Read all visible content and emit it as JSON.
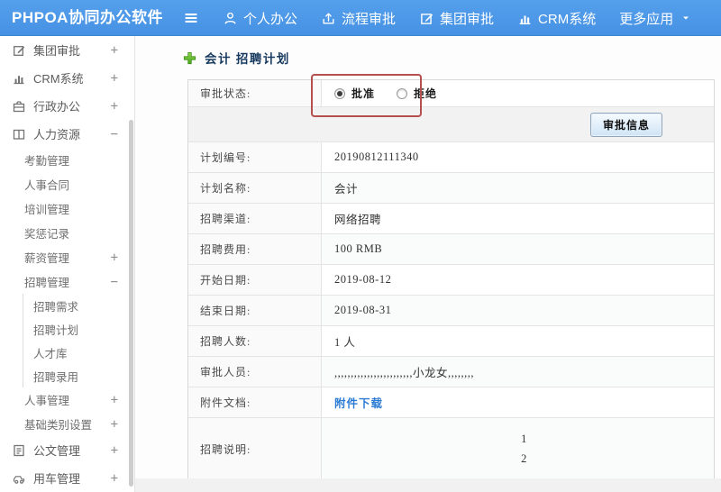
{
  "topbar": {
    "brand": "PHPOA协同办公软件",
    "nav": [
      {
        "label": "个人办公",
        "icon": "user-icon"
      },
      {
        "label": "流程审批",
        "icon": "flow-icon"
      },
      {
        "label": "集团审批",
        "icon": "edit-icon"
      },
      {
        "label": "CRM系统",
        "icon": "chart-icon"
      },
      {
        "label": "更多应用",
        "icon": "caret-down-icon"
      }
    ]
  },
  "sidebar": {
    "items": [
      {
        "label": "集团审批",
        "icon": "edit-icon",
        "level": 1,
        "expander": "+"
      },
      {
        "label": "CRM系统",
        "icon": "chart-icon",
        "level": 1,
        "expander": "+"
      },
      {
        "label": "行政办公",
        "icon": "briefcase-icon",
        "level": 1,
        "expander": "+"
      },
      {
        "label": "人力资源",
        "icon": "book-icon",
        "level": 1,
        "expander": "−"
      },
      {
        "label": "考勤管理",
        "level": 2
      },
      {
        "label": "人事合同",
        "level": 2
      },
      {
        "label": "培训管理",
        "level": 2
      },
      {
        "label": "奖惩记录",
        "level": 2
      },
      {
        "label": "薪资管理",
        "level": 2,
        "expander": "+"
      },
      {
        "label": "招聘管理",
        "level": 2,
        "expander": "−"
      },
      {
        "label": "招聘需求",
        "level": 3
      },
      {
        "label": "招聘计划",
        "level": 3
      },
      {
        "label": "人才库",
        "level": 3
      },
      {
        "label": "招聘录用",
        "level": 3
      },
      {
        "label": "人事管理",
        "level": 2,
        "expander": "+"
      },
      {
        "label": "基础类别设置",
        "level": 2,
        "expander": "+"
      },
      {
        "label": "公文管理",
        "icon": "document-icon",
        "level": 1,
        "expander": "+"
      },
      {
        "label": "用车管理",
        "icon": "car-icon",
        "level": 1,
        "expander": "+"
      }
    ]
  },
  "main": {
    "title": "会计 招聘计划",
    "status": {
      "label": "审批状态:",
      "options": [
        {
          "label": "批准",
          "checked": true
        },
        {
          "label": "拒绝",
          "checked": false
        }
      ],
      "button_label": "审批信息"
    },
    "fields": [
      {
        "label": "计划编号:",
        "value": "20190812111340"
      },
      {
        "label": "计划名称:",
        "value": "会计"
      },
      {
        "label": "招聘渠道:",
        "value": "网络招聘"
      },
      {
        "label": "招聘费用:",
        "value": "100 RMB"
      },
      {
        "label": "开始日期:",
        "value": "2019-08-12"
      },
      {
        "label": "结束日期:",
        "value": "2019-08-31"
      },
      {
        "label": "招聘人数:",
        "value": "1 人"
      },
      {
        "label": "审批人员:",
        "value": ",,,,,,,,,,,,,,,,,,,,,,,,小龙女,,,,,,,,"
      },
      {
        "label": "附件文档:",
        "value": "附件下载",
        "type": "link"
      },
      {
        "label": "招聘说明:",
        "type": "multiline",
        "lines": [
          "1",
          "2"
        ]
      }
    ]
  },
  "colors": {
    "topbar_blue": "#4a96e8",
    "highlight_red": "#b5504f",
    "link_blue": "#2b7bd4",
    "plus_green": "#5cb22c"
  }
}
